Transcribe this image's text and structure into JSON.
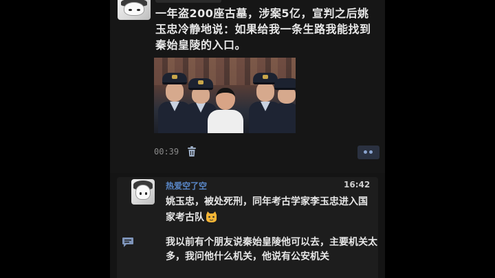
{
  "post": {
    "text": "一年盗200座古墓，涉案5亿，宣判之后姚玉忠冷静地说：如果给我一条生路我能找到秦始皇陵的入口。",
    "duration": "00:39"
  },
  "comment": {
    "author": "热爱空了空",
    "time": "16:42",
    "text": "姚玉忠，被处死刑，同年考古学家李玉忠进入国家考古队",
    "reply": "我以前有个朋友说秦始皇陵他可以去，主要机关太多，我问他什么机关，他说有公安机关"
  },
  "icons": {
    "delete": "trash-icon",
    "more": "more-dots-icon",
    "emoji": "cat-emoji-icon",
    "reply": "comment-bubble-icon"
  },
  "colors": {
    "author": "#5a88c9",
    "more_button_bg": "#2a3140",
    "background": "#141414"
  }
}
